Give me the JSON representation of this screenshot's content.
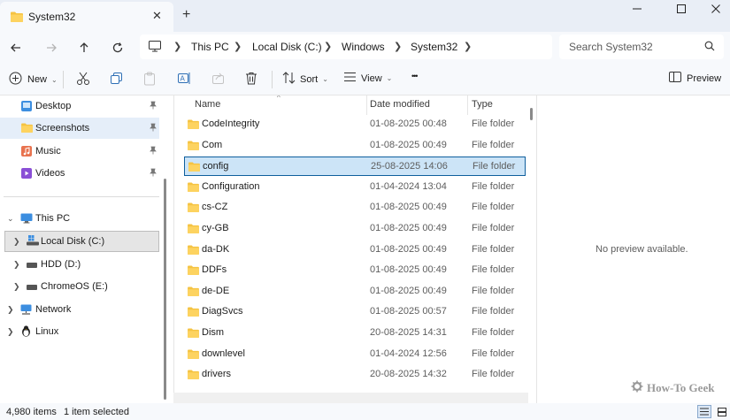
{
  "window": {
    "tab_title": "System32",
    "new_tab": "+",
    "close_tab": "✕"
  },
  "address": {
    "crumbs": [
      "This PC",
      "Local Disk (C:)",
      "Windows",
      "System32"
    ],
    "search_placeholder": "Search System32"
  },
  "commandbar": {
    "new_label": "New",
    "sort_label": "Sort",
    "view_label": "View",
    "more_label": "•••",
    "preview_label": "Preview"
  },
  "navpane": {
    "quick_access": [
      {
        "label": "Desktop",
        "icon": "desktop-icon"
      },
      {
        "label": "Screenshots",
        "icon": "folder-icon"
      },
      {
        "label": "Music",
        "icon": "music-icon"
      },
      {
        "label": "Videos",
        "icon": "video-icon"
      }
    ],
    "this_pc": "This PC",
    "drives": [
      "Local Disk (C:)",
      "HDD (D:)",
      "ChromeOS (E:)"
    ],
    "network": "Network",
    "linux": "Linux"
  },
  "filelist": {
    "columns": {
      "name": "Name",
      "date": "Date modified",
      "type": "Type"
    },
    "rows": [
      {
        "name": "CodeIntegrity",
        "date": "01-08-2025 00:48",
        "type": "File folder"
      },
      {
        "name": "Com",
        "date": "01-08-2025 00:49",
        "type": "File folder"
      },
      {
        "name": "config",
        "date": "25-08-2025 14:06",
        "type": "File folder"
      },
      {
        "name": "Configuration",
        "date": "01-04-2024 13:04",
        "type": "File folder"
      },
      {
        "name": "cs-CZ",
        "date": "01-08-2025 00:49",
        "type": "File folder"
      },
      {
        "name": "cy-GB",
        "date": "01-08-2025 00:49",
        "type": "File folder"
      },
      {
        "name": "da-DK",
        "date": "01-08-2025 00:49",
        "type": "File folder"
      },
      {
        "name": "DDFs",
        "date": "01-08-2025 00:49",
        "type": "File folder"
      },
      {
        "name": "de-DE",
        "date": "01-08-2025 00:49",
        "type": "File folder"
      },
      {
        "name": "DiagSvcs",
        "date": "01-08-2025 00:57",
        "type": "File folder"
      },
      {
        "name": "Dism",
        "date": "20-08-2025 14:31",
        "type": "File folder"
      },
      {
        "name": "downlevel",
        "date": "01-04-2024 12:56",
        "type": "File folder"
      },
      {
        "name": "drivers",
        "date": "20-08-2025 14:32",
        "type": "File folder"
      }
    ]
  },
  "preview": {
    "empty_text": "No preview available.",
    "watermark": "How-To Geek"
  },
  "status": {
    "item_count": "4,980 items",
    "selection": "1 item selected"
  },
  "colors": {
    "accent": "#0f5f9d",
    "selection": "#cce4f7",
    "folder": "#f5c342"
  }
}
